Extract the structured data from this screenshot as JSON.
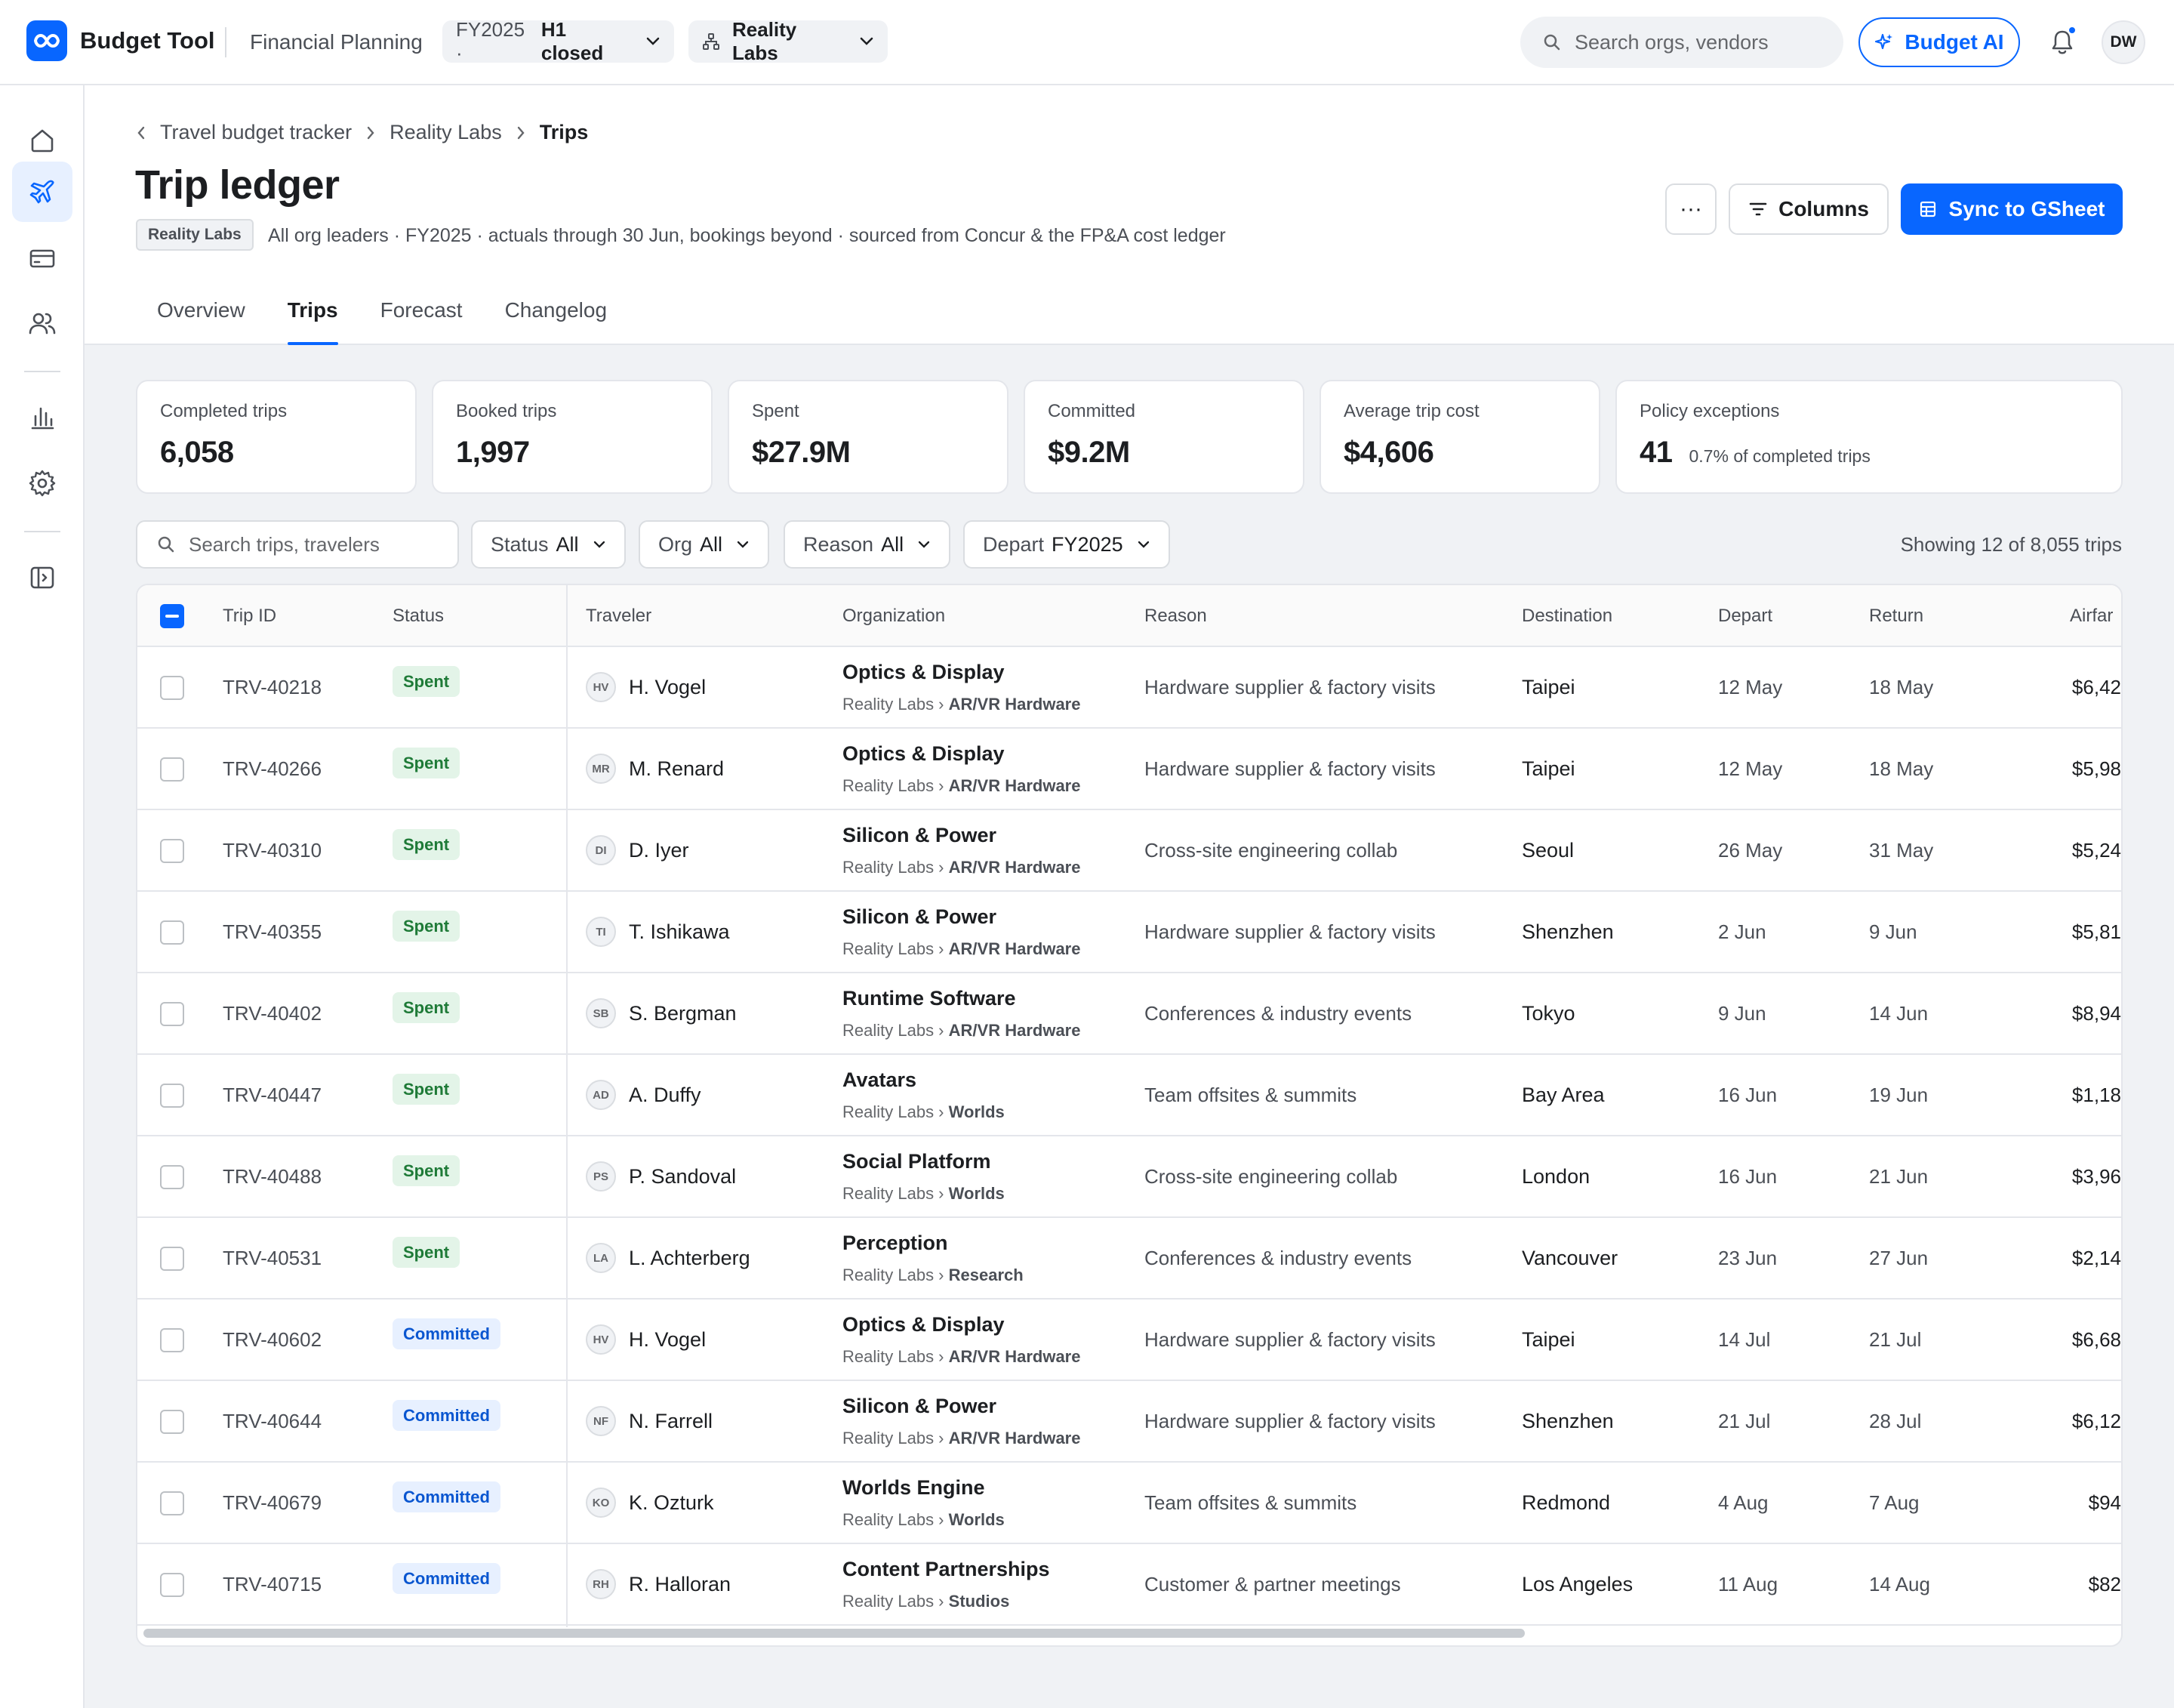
{
  "app": {
    "name": "Budget Tool",
    "section": "Financial Planning",
    "fy_prefix": "FY2025 ·",
    "fy_status": "H1 closed",
    "org_selector": "Reality Labs",
    "search_placeholder": "Search orgs, vendors",
    "ai_button": "Budget AI",
    "user_initials": "DW"
  },
  "sidebar": {
    "items": [
      "home-icon",
      "plane-icon",
      "card-icon",
      "people-icon",
      "chart-icon",
      "gear-icon",
      "panel-icon"
    ],
    "active": "plane-icon"
  },
  "breadcrumb": {
    "items": [
      "Travel budget tracker",
      "Reality Labs"
    ],
    "current": "Trips"
  },
  "page": {
    "title": "Trip ledger",
    "tag": "Reality Labs",
    "description": "All org leaders · FY2025 · actuals through 30 Jun, bookings beyond · sourced from Concur & the FP&A cost ledger",
    "more_label": "···",
    "columns_button": "Columns",
    "sync_button": "Sync to GSheet"
  },
  "tabs": [
    {
      "label": "Overview",
      "active": false
    },
    {
      "label": "Trips",
      "active": true
    },
    {
      "label": "Forecast",
      "active": false
    },
    {
      "label": "Changelog",
      "active": false
    }
  ],
  "kpis": [
    {
      "label": "Completed trips",
      "value": "6,058"
    },
    {
      "label": "Booked trips",
      "value": "1,997"
    },
    {
      "label": "Spent",
      "value": "$27.9M"
    },
    {
      "label": "Committed",
      "value": "$9.2M"
    },
    {
      "label": "Average trip cost",
      "value": "$4,606"
    },
    {
      "label": "Policy exceptions",
      "value": "41",
      "note": "0.7% of completed trips"
    }
  ],
  "filters": {
    "search_placeholder": "Search trips, travelers",
    "status": {
      "label": "Status",
      "value": "All"
    },
    "org": {
      "label": "Org",
      "value": "All"
    },
    "reason": {
      "label": "Reason",
      "value": "All"
    },
    "depart": {
      "label": "Depart",
      "value": "FY2025"
    },
    "showing": "Showing 12 of 8,055 trips"
  },
  "table": {
    "headers": {
      "trip_id": "Trip ID",
      "status": "Status",
      "traveler": "Traveler",
      "organization": "Organization",
      "reason": "Reason",
      "destination": "Destination",
      "depart": "Depart",
      "return": "Return",
      "airfare": "Airfar"
    },
    "rows": [
      {
        "id": "TRV-40218",
        "status": "Spent",
        "initials": "HV",
        "traveler": "H. Vogel",
        "org": "Optics & Display",
        "parent": "Reality Labs ›",
        "group": "AR/VR Hardware",
        "reason": "Hardware supplier & factory visits",
        "dest": "Taipei",
        "depart": "12 May",
        "return": "18 May",
        "airfare": "$6,42"
      },
      {
        "id": "TRV-40266",
        "status": "Spent",
        "initials": "MR",
        "traveler": "M. Renard",
        "org": "Optics & Display",
        "parent": "Reality Labs ›",
        "group": "AR/VR Hardware",
        "reason": "Hardware supplier & factory visits",
        "dest": "Taipei",
        "depart": "12 May",
        "return": "18 May",
        "airfare": "$5,98"
      },
      {
        "id": "TRV-40310",
        "status": "Spent",
        "initials": "DI",
        "traveler": "D. Iyer",
        "org": "Silicon & Power",
        "parent": "Reality Labs ›",
        "group": "AR/VR Hardware",
        "reason": "Cross-site engineering collab",
        "dest": "Seoul",
        "depart": "26 May",
        "return": "31 May",
        "airfare": "$5,24"
      },
      {
        "id": "TRV-40355",
        "status": "Spent",
        "initials": "TI",
        "traveler": "T. Ishikawa",
        "org": "Silicon & Power",
        "parent": "Reality Labs ›",
        "group": "AR/VR Hardware",
        "reason": "Hardware supplier & factory visits",
        "dest": "Shenzhen",
        "depart": "2 Jun",
        "return": "9 Jun",
        "airfare": "$5,81"
      },
      {
        "id": "TRV-40402",
        "status": "Spent",
        "initials": "SB",
        "traveler": "S. Bergman",
        "org": "Runtime Software",
        "parent": "Reality Labs ›",
        "group": "AR/VR Hardware",
        "reason": "Conferences & industry events",
        "dest": "Tokyo",
        "depart": "9 Jun",
        "return": "14 Jun",
        "airfare": "$8,94"
      },
      {
        "id": "TRV-40447",
        "status": "Spent",
        "initials": "AD",
        "traveler": "A. Duffy",
        "org": "Avatars",
        "parent": "Reality Labs ›",
        "group": "Worlds",
        "reason": "Team offsites & summits",
        "dest": "Bay Area",
        "depart": "16 Jun",
        "return": "19 Jun",
        "airfare": "$1,18"
      },
      {
        "id": "TRV-40488",
        "status": "Spent",
        "initials": "PS",
        "traveler": "P. Sandoval",
        "org": "Social Platform",
        "parent": "Reality Labs ›",
        "group": "Worlds",
        "reason": "Cross-site engineering collab",
        "dest": "London",
        "depart": "16 Jun",
        "return": "21 Jun",
        "airfare": "$3,96"
      },
      {
        "id": "TRV-40531",
        "status": "Spent",
        "initials": "LA",
        "traveler": "L. Achterberg",
        "org": "Perception",
        "parent": "Reality Labs ›",
        "group": "Research",
        "reason": "Conferences & industry events",
        "dest": "Vancouver",
        "depart": "23 Jun",
        "return": "27 Jun",
        "airfare": "$2,14"
      },
      {
        "id": "TRV-40602",
        "status": "Committed",
        "initials": "HV",
        "traveler": "H. Vogel",
        "org": "Optics & Display",
        "parent": "Reality Labs ›",
        "group": "AR/VR Hardware",
        "reason": "Hardware supplier & factory visits",
        "dest": "Taipei",
        "depart": "14 Jul",
        "return": "21 Jul",
        "airfare": "$6,68"
      },
      {
        "id": "TRV-40644",
        "status": "Committed",
        "initials": "NF",
        "traveler": "N. Farrell",
        "org": "Silicon & Power",
        "parent": "Reality Labs ›",
        "group": "AR/VR Hardware",
        "reason": "Hardware supplier & factory visits",
        "dest": "Shenzhen",
        "depart": "21 Jul",
        "return": "28 Jul",
        "airfare": "$6,12"
      },
      {
        "id": "TRV-40679",
        "status": "Committed",
        "initials": "KO",
        "traveler": "K. Ozturk",
        "org": "Worlds Engine",
        "parent": "Reality Labs ›",
        "group": "Worlds",
        "reason": "Team offsites & summits",
        "dest": "Redmond",
        "depart": "4 Aug",
        "return": "7 Aug",
        "airfare": "$94"
      },
      {
        "id": "TRV-40715",
        "status": "Committed",
        "initials": "RH",
        "traveler": "R. Halloran",
        "org": "Content Partnerships",
        "parent": "Reality Labs ›",
        "group": "Studios",
        "reason": "Customer & partner meetings",
        "dest": "Los Angeles",
        "depart": "11 Aug",
        "return": "14 Aug",
        "airfare": "$82"
      }
    ]
  },
  "colors": {
    "accent": "#0866ff",
    "spent_bg": "#e3f4e8",
    "spent_text": "#1e7a37",
    "committed_bg": "#e7f0ff",
    "committed_text": "#0a56d0"
  }
}
